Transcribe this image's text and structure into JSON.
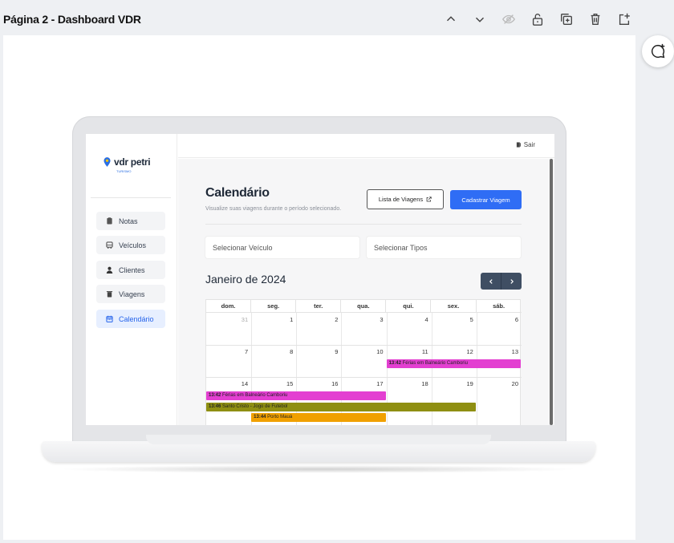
{
  "editor": {
    "page_title": "Página 2 - Dashboard VDR",
    "tools": [
      "chevron-up-icon",
      "chevron-down-icon",
      "eye-off-icon",
      "unlock-icon",
      "duplicate-icon",
      "trash-icon",
      "add-page-icon"
    ],
    "side_tool": "add-comment-icon"
  },
  "app": {
    "logo_text": "vdr petri",
    "logo_sub": "TURISMO",
    "brand_color": "#2f6df5",
    "nav": [
      {
        "label": "Notas",
        "icon": "clipboard-icon",
        "active": false
      },
      {
        "label": "Veículos",
        "icon": "bus-icon",
        "active": false
      },
      {
        "label": "Clientes",
        "icon": "user-icon",
        "active": false
      },
      {
        "label": "Viagens",
        "icon": "trash-icon",
        "active": false
      },
      {
        "label": "Calendário",
        "icon": "calendar-icon",
        "active": true
      }
    ],
    "logout_label": "Sair",
    "title": "Calendário",
    "subtitle": "Visualize suas viagens durante o período selecionado.",
    "btn_list": "Lista de Viagens",
    "btn_new": "Cadastrar Viagem",
    "select_vehicle": "Selecionar Veículo",
    "select_types": "Selecionar Tipos",
    "month_label": "Janeiro de 2024",
    "weekdays": [
      "dom.",
      "seg.",
      "ter.",
      "qua.",
      "qui.",
      "sex.",
      "sáb."
    ],
    "weeks": [
      [
        "31",
        "1",
        "2",
        "3",
        "4",
        "5",
        "6"
      ],
      [
        "7",
        "8",
        "9",
        "10",
        "11",
        "12",
        "13"
      ],
      [
        "14",
        "15",
        "16",
        "17",
        "18",
        "19",
        "20"
      ]
    ],
    "events": [
      {
        "time": "13:42",
        "title": "Férias em Balneário Camboriu",
        "color": "#e33fd1",
        "week": 1,
        "start": 4,
        "span": 3,
        "lane": 0
      },
      {
        "time": "13:42",
        "title": "Férias em Balneário Camboriu",
        "color": "#e33fd1",
        "week": 2,
        "start": 0,
        "span": 4,
        "lane": 0
      },
      {
        "time": "13:46",
        "title": "Santo Cristo - Jogo de Futebol",
        "color": "#8f8f12",
        "week": 2,
        "start": 0,
        "span": 6,
        "lane": 1
      },
      {
        "time": "13:44",
        "title": "Porto Mauá",
        "color": "#f0a000",
        "week": 2,
        "start": 1,
        "span": 3,
        "lane": 2
      }
    ]
  }
}
